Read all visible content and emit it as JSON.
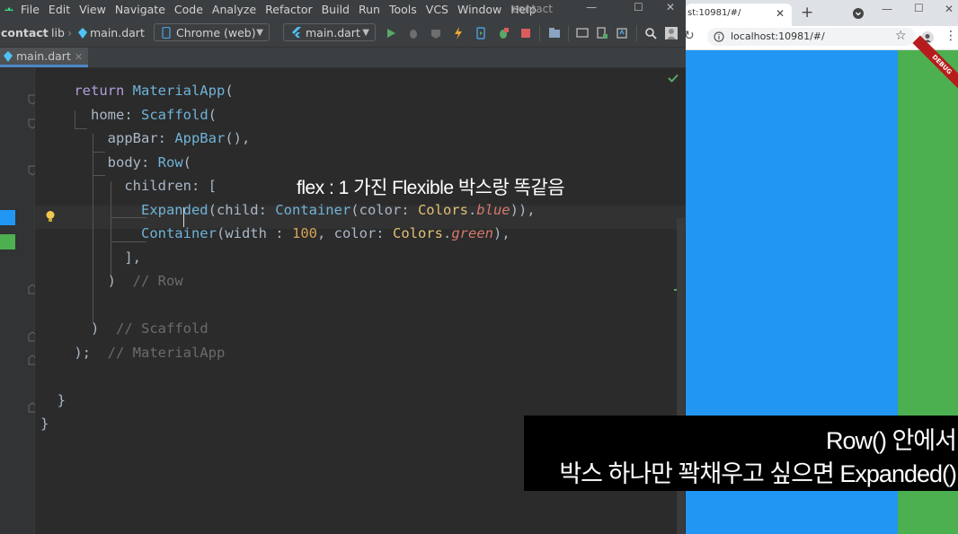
{
  "ide": {
    "menu": [
      "File",
      "Edit",
      "View",
      "Navigate",
      "Code",
      "Analyze",
      "Refactor",
      "Build",
      "Run",
      "Tools",
      "VCS",
      "Window",
      "Help"
    ],
    "project_title": "contact",
    "breadcrumb": [
      "contact",
      "lib",
      "main.dart"
    ],
    "device_select": "Chrome (web)",
    "run_config": "main.dart",
    "editor_tab": "main.dart",
    "code_lines": [
      {
        "indent": "    ",
        "parts": [
          [
            "kw2",
            "return "
          ],
          [
            "cls",
            "MaterialApp"
          ],
          [
            "p",
            "("
          ]
        ]
      },
      {
        "indent": "      ",
        "parts": [
          [
            "p",
            "home: "
          ],
          [
            "cls",
            "Scaffold"
          ],
          [
            "p",
            "("
          ]
        ]
      },
      {
        "indent": "        ",
        "parts": [
          [
            "p",
            "appBar: "
          ],
          [
            "cls",
            "AppBar"
          ],
          [
            "p",
            "(),"
          ]
        ]
      },
      {
        "indent": "        ",
        "parts": [
          [
            "p",
            "body: "
          ],
          [
            "cls",
            "Row"
          ],
          [
            "p",
            "("
          ]
        ]
      },
      {
        "indent": "          ",
        "parts": [
          [
            "p",
            "children: ["
          ]
        ]
      },
      {
        "indent": "            ",
        "parts": [
          [
            "cls",
            "Expanded"
          ],
          [
            "p",
            "(child: "
          ],
          [
            "cls",
            "Container"
          ],
          [
            "p",
            "(color: "
          ],
          [
            "prop",
            "Colors"
          ],
          [
            "p",
            "."
          ],
          [
            "it",
            "blue"
          ],
          [
            "p",
            ")),"
          ]
        ]
      },
      {
        "indent": "            ",
        "parts": [
          [
            "cls",
            "Container"
          ],
          [
            "p",
            "(width : "
          ],
          [
            "num",
            "100"
          ],
          [
            "p",
            ", color: "
          ],
          [
            "prop",
            "Colors"
          ],
          [
            "p",
            "."
          ],
          [
            "it",
            "green"
          ],
          [
            "p",
            "),"
          ]
        ]
      },
      {
        "indent": "          ",
        "parts": [
          [
            "p",
            "],"
          ]
        ]
      },
      {
        "indent": "        ",
        "parts": [
          [
            "p",
            ")  "
          ],
          [
            "cm",
            "// Row"
          ]
        ]
      },
      {
        "indent": "",
        "parts": []
      },
      {
        "indent": "      ",
        "parts": [
          [
            "p",
            ")  "
          ],
          [
            "cm",
            "// Scaffold"
          ]
        ]
      },
      {
        "indent": "    ",
        "parts": [
          [
            "p",
            ");  "
          ],
          [
            "cm",
            "// MaterialApp"
          ]
        ]
      },
      {
        "indent": "",
        "parts": []
      },
      {
        "indent": "  ",
        "parts": [
          [
            "p",
            "}"
          ]
        ]
      },
      {
        "indent": "",
        "parts": [
          [
            "p",
            "}"
          ]
        ]
      }
    ]
  },
  "overlay_note": "flex : 1 가진 Flexible 박스랑 똑같음",
  "browser": {
    "tab_title": "st:10981/#/",
    "url": "localhost:10981/#/",
    "debug_banner": "DEBUG"
  },
  "caption": {
    "line1": "Row() 안에서",
    "line2": "박스 하나만 꽉채우고 싶으면 Expanded()"
  },
  "colors": {
    "flutter_blue": "#2196f3",
    "flutter_green": "#4caf50",
    "ide_bg": "#2b2b2b"
  }
}
